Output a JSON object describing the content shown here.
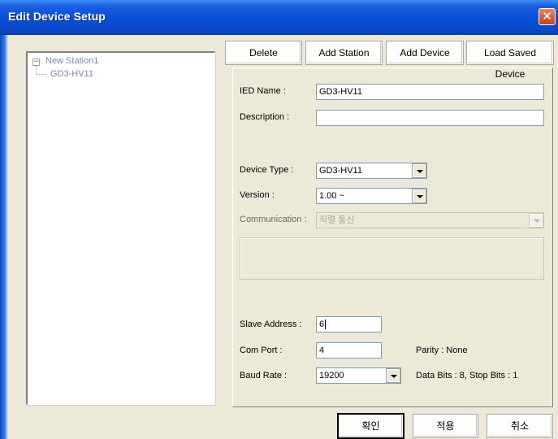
{
  "window": {
    "title": "Edit Device Setup",
    "close_glyph": "✕"
  },
  "tree": {
    "expander_glyph": "−",
    "root": "New Station1",
    "child": "GD3-HV11"
  },
  "toolbar": {
    "delete": "Delete",
    "add_station": "Add Station",
    "add_device": "Add Device",
    "load_saved_device": "Load Saved Device"
  },
  "form": {
    "ied_name_label": "IED Name :",
    "ied_name_value": "GD3-HV11",
    "description_label": "Description :",
    "description_value": "",
    "device_type_label": "Device Type :",
    "device_type_value": "GD3-HV11",
    "version_label": "Version :",
    "version_value": "1.00 ~",
    "communication_label": "Communication :",
    "communication_value": "직렬 통신",
    "slave_address_label": "Slave Address :",
    "slave_address_value": "6",
    "com_port_label": "Com Port :",
    "com_port_value": "4",
    "parity_text": "Parity : None",
    "baud_rate_label": "Baud Rate :",
    "baud_rate_value": "19200",
    "data_bits_text": "Data Bits : 8, Stop Bits : 1"
  },
  "footer": {
    "ok": "확인",
    "apply": "적용",
    "cancel": "취소"
  },
  "colors": {
    "titlebar": "#0a4fd6",
    "tree_text": "#7a86b8",
    "background": "#ece9d8"
  }
}
